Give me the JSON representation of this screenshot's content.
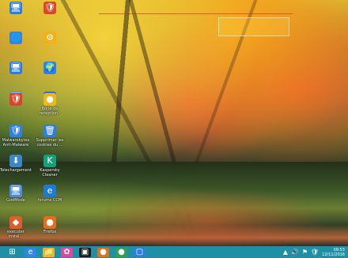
{
  "desktop": {
    "icons": [
      {
        "name": "blue-folder-icon",
        "glyph": "🖥",
        "label": "",
        "color": "#2a7de1"
      },
      {
        "name": "shield-icon",
        "glyph": "🛡",
        "label": "",
        "color": "#d94a2b"
      },
      {
        "name": "network-icon",
        "glyph": "🌐",
        "label": "",
        "color": "#3f7fdc"
      },
      {
        "name": "cog-icon",
        "glyph": "⚙",
        "label": "",
        "color": "#f0b11a"
      },
      {
        "name": "computer-icon",
        "glyph": "🖥",
        "label": "",
        "color": "#2a7de1"
      },
      {
        "name": "globe-icon",
        "glyph": "🌍",
        "label": "",
        "color": "#2f7fe4"
      },
      {
        "name": "network-drive-icon",
        "glyph": "🗄",
        "label": "",
        "color": "#4c8fe6"
      },
      {
        "name": "help-icon",
        "glyph": "?",
        "label": "",
        "color": "#2f6fe2"
      },
      {
        "name": "antivirus-icon",
        "glyph": "🛡",
        "label": "",
        "color": "#d8452a"
      },
      {
        "name": "chrome-icon",
        "glyph": "●",
        "label": "Boite de\nreception -",
        "color": "#e8b81d"
      },
      {
        "name": "malwarebytes-icon",
        "glyph": "🛡",
        "label": "Malwarebytes\nAnti-Malware",
        "color": "#2f7fe4"
      },
      {
        "name": "delete-cookies-icon",
        "glyph": "🗑",
        "label": "Supprimer les\ncookies du ...",
        "color": "#2a7de1"
      },
      {
        "name": "telechargement-icon",
        "glyph": "⬇",
        "label": "Telechargement",
        "color": "#3b86c9"
      },
      {
        "name": "kaspersky-icon",
        "glyph": "K",
        "label": "Kaspersky\nCleaner",
        "color": "#15a07a"
      },
      {
        "name": "godmode-icon",
        "glyph": "🖥",
        "label": "GodMode",
        "color": "#4a8de0"
      },
      {
        "name": "forums-ccm-icon",
        "glyph": "e",
        "label": "forums CCM",
        "color": "#1f7ad6"
      },
      {
        "name": "executer-icon",
        "glyph": "◆",
        "label": "executer\ninstal...",
        "color": "#e05d2a"
      },
      {
        "name": "firefox-icon",
        "glyph": "●",
        "label": "Firefox",
        "color": "#e56d1e"
      }
    ]
  },
  "taskbar": {
    "start_icon": "⊞",
    "items": [
      {
        "name": "ie-taskbar-icon",
        "glyph": "e",
        "color": "#2e86e6"
      },
      {
        "name": "explorer-taskbar-icon",
        "glyph": "📁",
        "color": "#e9b52d"
      },
      {
        "name": "app1-taskbar-icon",
        "glyph": "✿",
        "color": "#d94aa0"
      },
      {
        "name": "terminal-taskbar-icon",
        "glyph": "▣",
        "color": "#1a1a1a"
      },
      {
        "name": "firefox-taskbar-icon",
        "glyph": "●",
        "color": "#e56d1e"
      },
      {
        "name": "chrome-taskbar-icon",
        "glyph": "●",
        "color": "#2ca24a"
      },
      {
        "name": "window-taskbar-icon",
        "glyph": "▢",
        "color": "#2a7de1"
      }
    ],
    "clock_time": "09:53",
    "clock_date": "12/11/2016",
    "tray_icons": [
      "▲",
      "🔊",
      "⚑",
      "🛡"
    ]
  }
}
